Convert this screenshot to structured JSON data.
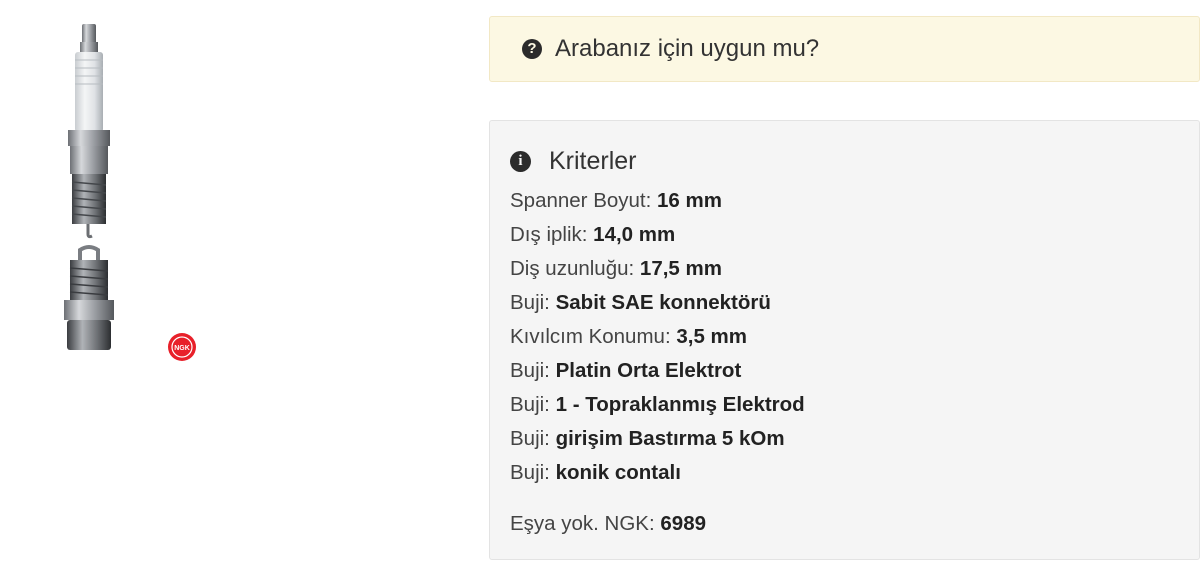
{
  "fit_check": {
    "icon": "question-circle-icon",
    "text": "Arabanız için uygun mu?",
    "background": "#fcf8e3"
  },
  "criteria": {
    "icon": "info-circle-icon",
    "title": "Kriterler",
    "items": [
      {
        "label": "Spanner Boyut:",
        "value": "16 mm"
      },
      {
        "label": "Dış iplik:",
        "value": "14,0 mm"
      },
      {
        "label": "Diş uzunluğu:",
        "value": "17,5 mm"
      },
      {
        "label": "Buji:",
        "value": "Sabit SAE konnektörü"
      },
      {
        "label": "Kıvılcım Konumu:",
        "value": "3,5 mm"
      },
      {
        "label": "Buji:",
        "value": "Platin Orta Elektrot"
      },
      {
        "label": "Buji:",
        "value": "1 - Topraklanmış Elektrod"
      },
      {
        "label": "Buji:",
        "value": "girişim Bastırma 5 kOm"
      },
      {
        "label": "Buji:",
        "value": "konik contalı"
      }
    ],
    "item_number": {
      "label": "Eşya yok. NGK:",
      "value": "6989"
    }
  },
  "product_image": {
    "subject": "spark plug",
    "brand_logo": "NGK",
    "logo_color": "#e8202a"
  }
}
